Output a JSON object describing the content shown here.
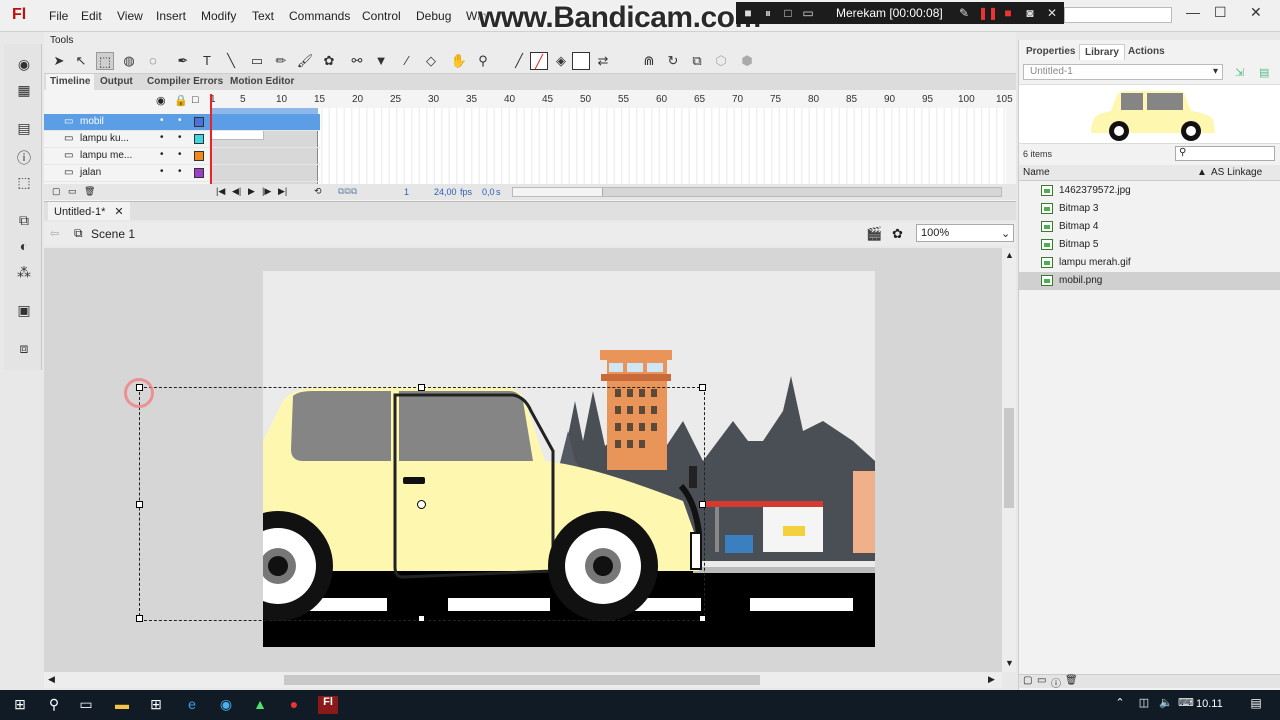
{
  "menu": {
    "logo": "Fl",
    "items": [
      "File",
      "Edit",
      "View",
      "Insert",
      "Modify",
      "Text",
      "Commands",
      "Control",
      "Debug",
      "Win"
    ]
  },
  "watermark": "www.Bandicam.com",
  "recorder": {
    "status": "Merekam [00:00:08]"
  },
  "tools_label": "Tools",
  "timeline": {
    "tabs": [
      "Timeline",
      "Output",
      "Compiler Errors",
      "Motion Editor"
    ],
    "ruler": [
      "1",
      "5",
      "10",
      "15",
      "20",
      "25",
      "30",
      "35",
      "40",
      "45",
      "50",
      "55",
      "60",
      "65",
      "70",
      "75",
      "80",
      "85",
      "90",
      "95",
      "100",
      "105"
    ],
    "layers": [
      {
        "name": "mobil",
        "color": "#4a72d8",
        "selected": true
      },
      {
        "name": "lampu ku...",
        "color": "#3ed6e0",
        "selected": false
      },
      {
        "name": "lampu me...",
        "color": "#f08a1c",
        "selected": false
      },
      {
        "name": "jalan",
        "color": "#9b3fc4",
        "selected": false
      }
    ],
    "current_frame": "1",
    "fps": "24,00",
    "fps_unit": "fps",
    "time": "0,0",
    "time_unit": "s"
  },
  "document": {
    "tab": "Untitled-1*",
    "scene": "Scene 1",
    "zoom": "100%"
  },
  "library": {
    "tabs": [
      "Properties",
      "Library",
      "Actions"
    ],
    "document_select": "Untitled-1",
    "item_count": "6 items",
    "col_name": "Name",
    "col_linkage": "AS Linkage",
    "items": [
      {
        "name": "1462379572.jpg",
        "selected": false
      },
      {
        "name": "Bitmap 3",
        "selected": false
      },
      {
        "name": "Bitmap 4",
        "selected": false
      },
      {
        "name": "Bitmap 5",
        "selected": false
      },
      {
        "name": "lampu merah.gif",
        "selected": false
      },
      {
        "name": "mobil.png",
        "selected": true
      }
    ]
  },
  "taskbar": {
    "time": "10.11"
  },
  "colors": {
    "car_body": "#fdf7b0",
    "car_window": "#858585",
    "road": "#000000",
    "stage": "#ebebeb",
    "selection": "#5c9ee5",
    "building": "#e9955a"
  }
}
